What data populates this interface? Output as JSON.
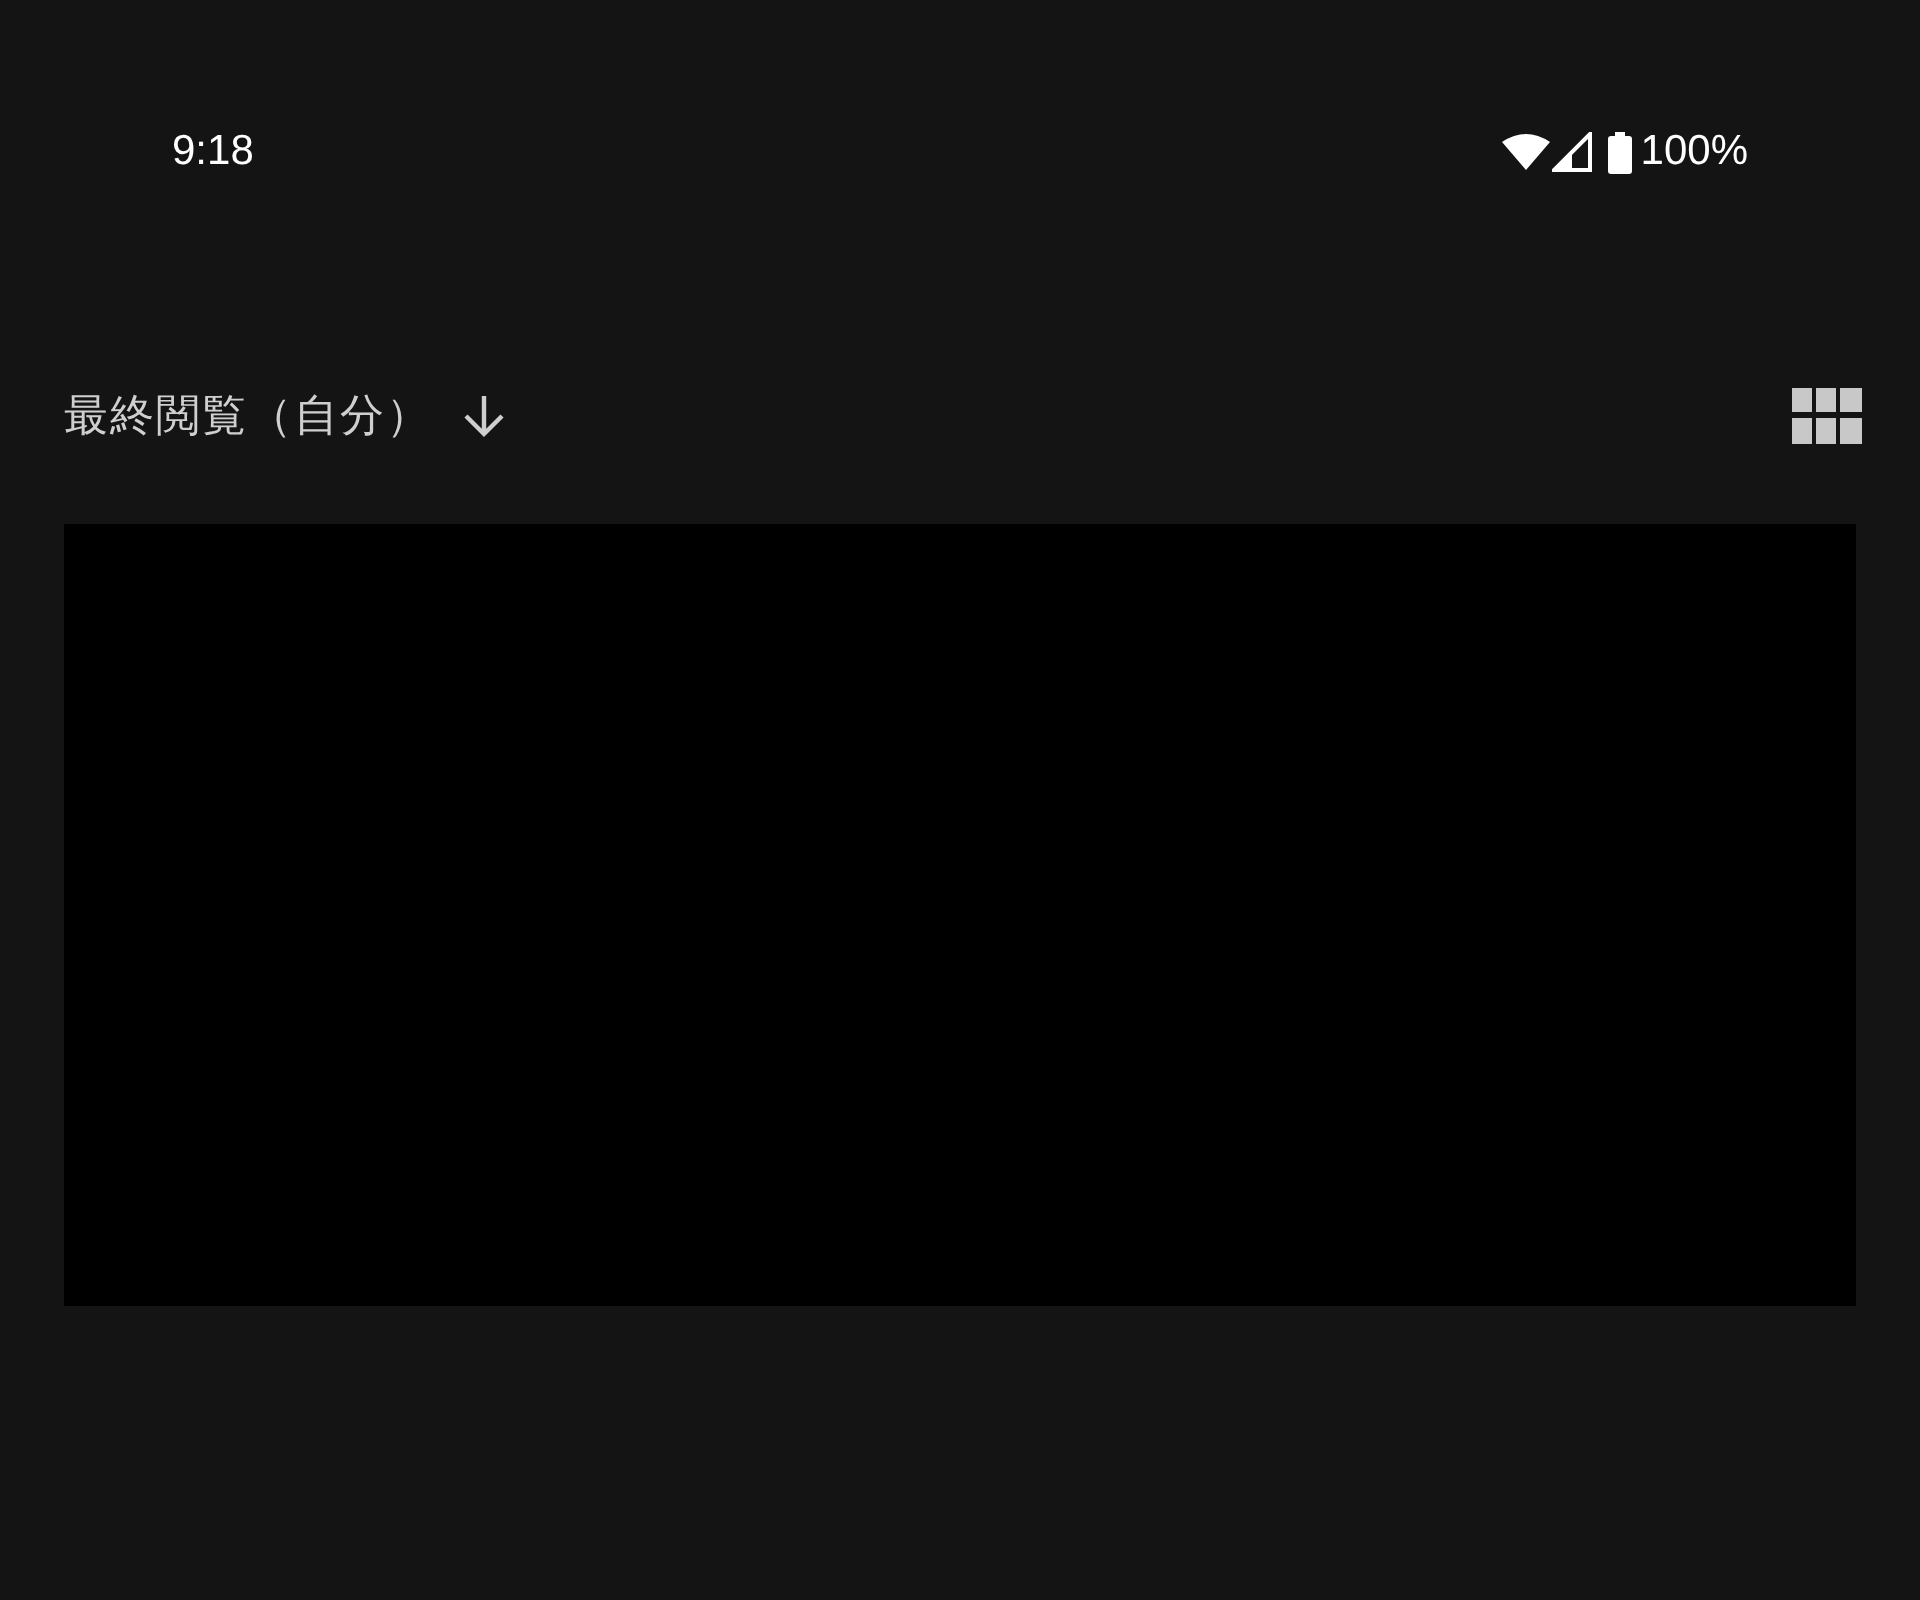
{
  "status_bar": {
    "time": "9:18",
    "battery": "100%"
  },
  "sort": {
    "label": "最終閲覧（自分）",
    "descending": true
  },
  "content": {
    "kind": "blank"
  }
}
